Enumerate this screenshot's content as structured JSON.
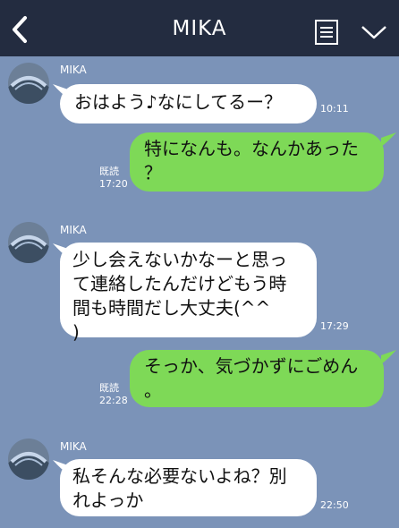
{
  "header": {
    "title": "MIKA",
    "back_icon": "chevron-left-icon",
    "note_icon": "note-icon",
    "menu_icon": "chevron-down-icon",
    "bg_color": "#232c40"
  },
  "colors": {
    "chat_bg": "#7b93b8",
    "incoming_bubble": "#ffffff",
    "outgoing_bubble": "#7ed957"
  },
  "messages": [
    {
      "direction": "incoming",
      "sender": "MIKA",
      "text": "おはよう♪なにしてるー？",
      "time": "10:11"
    },
    {
      "direction": "outgoing",
      "text": "特になんも。なんかあった\n？",
      "read": "既読",
      "time": "17:20"
    },
    {
      "direction": "incoming",
      "sender": "MIKA",
      "text": "少し会えないかなーと思っ\nて連絡したんだけどもう時\n間も時間だし大丈夫(^^\n)",
      "time": "17:29"
    },
    {
      "direction": "outgoing",
      "text": "そっか、気づかずにごめん\n。",
      "read": "既読",
      "time": "22:28"
    },
    {
      "direction": "incoming",
      "sender": "MIKA",
      "text": "私そんな必要ないよね？別\nれよっか",
      "time": "22:50"
    }
  ]
}
